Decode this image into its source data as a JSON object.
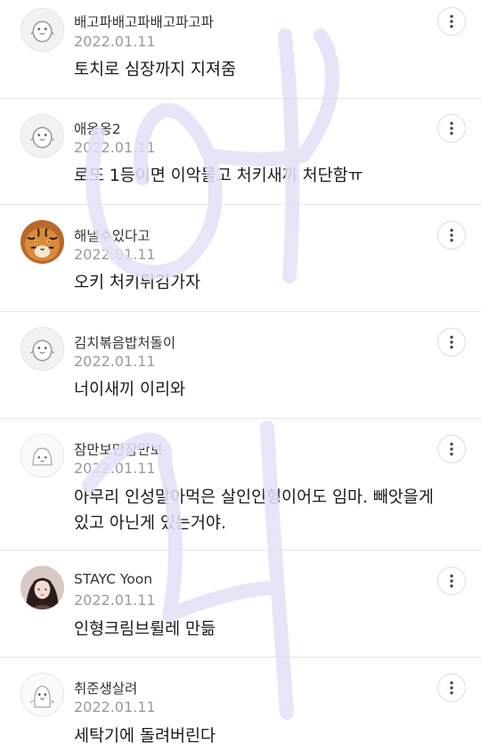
{
  "comments": [
    {
      "nickname": "배고파배고파배고파고파",
      "date": "2022.01.11",
      "text": "토치로 심장까지 지져줌",
      "avatar_icon": "chick-avatar-icon"
    },
    {
      "nickname": "애옹옹2",
      "date": "2022.01.11",
      "text": "로또 1등이면 이악물고 처키새끼 처단함ㅠ",
      "avatar_icon": "chick-avatar-icon"
    },
    {
      "nickname": "해낼수있다고",
      "date": "2022.01.11",
      "text": "오키 처키튀김가자",
      "avatar_icon": "tiger-avatar-icon"
    },
    {
      "nickname": "김치볶음밥처돌이",
      "date": "2022.01.11",
      "text": "너이새끼 이리와",
      "avatar_icon": "chick-avatar-icon"
    },
    {
      "nickname": "잠만보만잠만보",
      "date": "2022.01.11",
      "text": "아무리 인성말아먹은 살인인형이어도 임마. 빼앗을게 있고 아닌게 있는거야.",
      "avatar_icon": "ghost-avatar-icon"
    },
    {
      "nickname": "STAYC Yoon",
      "date": "2022.01.11",
      "text": "인형크림브륄레 만듦",
      "avatar_icon": "person-avatar-icon"
    },
    {
      "nickname": "취준생살려",
      "date": "2022.01.11",
      "text": "세탁기에 돌려버린다",
      "avatar_icon": "penguin-avatar-icon"
    }
  ],
  "more_button_icon": "more-vertical-icon",
  "colors": {
    "watermark": "#e3e0f7",
    "divider": "#e6e6e6",
    "date": "#9a9a9a"
  }
}
